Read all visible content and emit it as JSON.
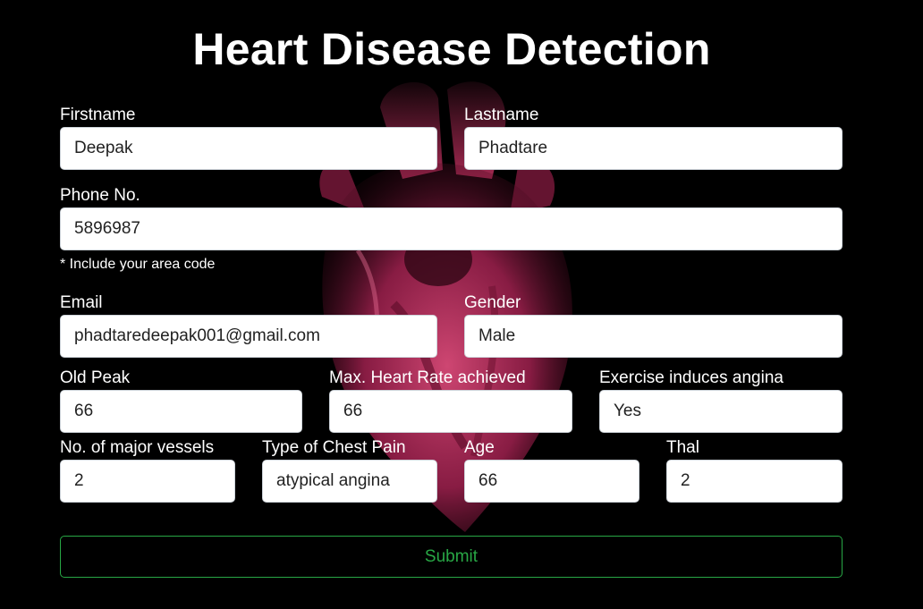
{
  "title": "Heart Disease Detection",
  "form": {
    "firstname": {
      "label": "Firstname",
      "value": "Deepak"
    },
    "lastname": {
      "label": "Lastname",
      "value": "Phadtare"
    },
    "phone": {
      "label": "Phone No.",
      "value": "5896987",
      "hint": "* Include your area code"
    },
    "email": {
      "label": "Email",
      "value": "phadtaredeepak001@gmail.com"
    },
    "gender": {
      "label": "Gender",
      "value": "Male"
    },
    "old_peak": {
      "label": "Old Peak",
      "value": "66"
    },
    "max_heart_rate": {
      "label": "Max. Heart Rate achieved",
      "value": "66"
    },
    "exercise_angina": {
      "label": "Exercise induces angina",
      "value": "Yes"
    },
    "major_vessels": {
      "label": "No. of major vessels",
      "value": "2"
    },
    "chest_pain": {
      "label": "Type of Chest Pain",
      "value": "atypical angina"
    },
    "age": {
      "label": "Age",
      "value": "66"
    },
    "thal": {
      "label": "Thal",
      "value": "2"
    },
    "submit_label": "Submit"
  },
  "colors": {
    "background": "#000000",
    "submit_accent": "#28a745",
    "heart": "#b8265a"
  },
  "icons": {
    "background_image": "heart-illustration"
  }
}
